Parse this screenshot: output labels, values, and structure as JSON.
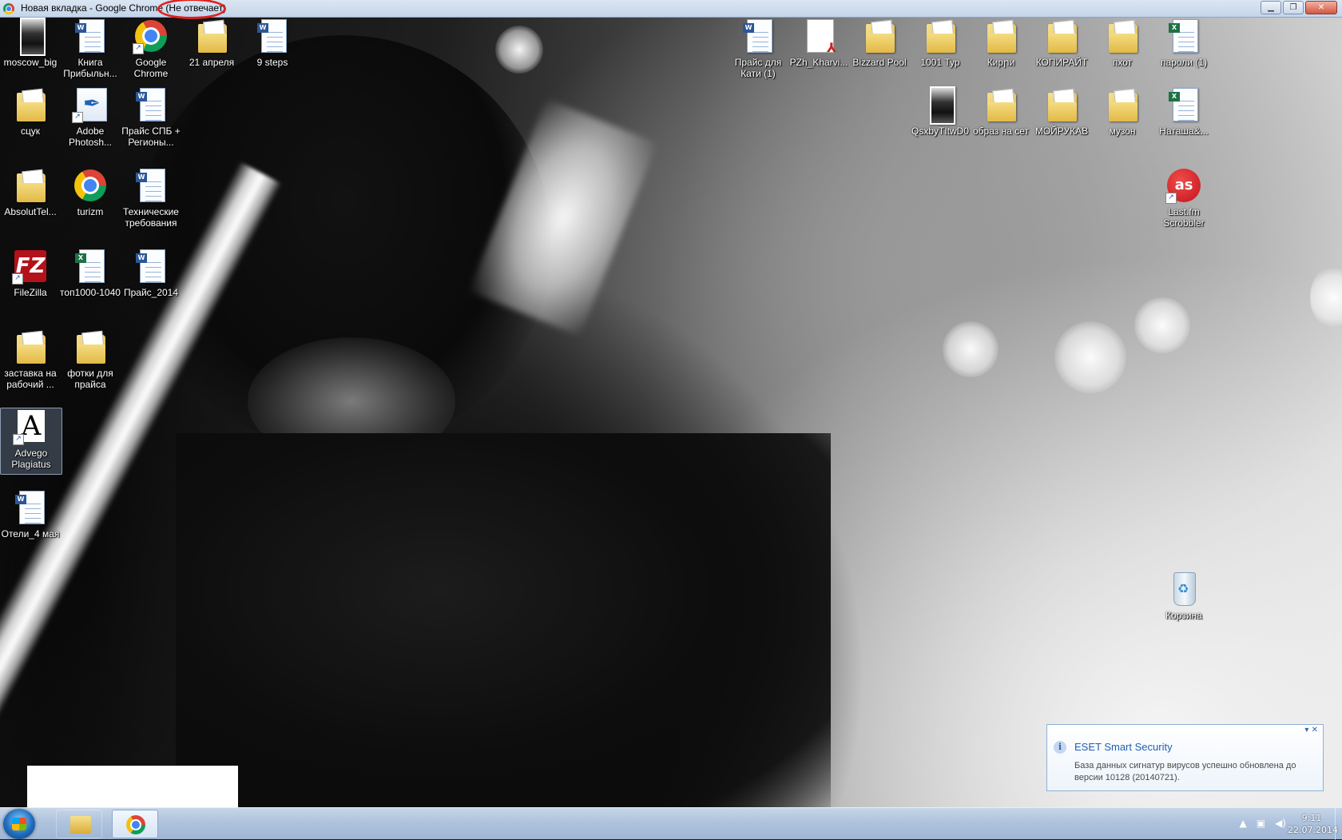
{
  "window": {
    "title": "Новая вкладка - Google Chrome (Не отвечает)",
    "buttons": {
      "minimize": "▁",
      "maximize": "❐",
      "close": "✕"
    }
  },
  "desktop": {
    "icons": [
      {
        "label": "moscow_big",
        "type": "photo"
      },
      {
        "label": "Книга Прибыльн...",
        "type": "doc-word"
      },
      {
        "label": "Google Chrome",
        "type": "chrome"
      },
      {
        "label": "21 апреля",
        "type": "folder"
      },
      {
        "label": "9 steps",
        "type": "doc-word"
      },
      {
        "label": "сцук",
        "type": "folder"
      },
      {
        "label": "Adobe Photosh...",
        "type": "photoshop"
      },
      {
        "label": "Прайс СПБ + Регионы...",
        "type": "doc-word"
      },
      {
        "label": "AbsolutTel...",
        "type": "folder"
      },
      {
        "label": "turizm",
        "type": "chrome"
      },
      {
        "label": "Технические требования",
        "type": "doc-word"
      },
      {
        "label": "FileZilla",
        "type": "filezilla"
      },
      {
        "label": "топ1000-1040",
        "type": "doc-excel"
      },
      {
        "label": "Прайс_2014",
        "type": "doc-word"
      },
      {
        "label": "заставка на рабочий ...",
        "type": "folder"
      },
      {
        "label": "фотки для прайса",
        "type": "folder"
      },
      {
        "label": "Advego Plagiatus",
        "type": "advego"
      },
      {
        "label": "Отели_4 мая",
        "type": "doc-word"
      },
      {
        "label": "Прайс для Кати (1)",
        "type": "doc-word"
      },
      {
        "label": "PZh_Kharvi...",
        "type": "pdf"
      },
      {
        "label": "Bizzard Pool",
        "type": "folder"
      },
      {
        "label": "1001 Тур",
        "type": "folder"
      },
      {
        "label": "Кирրи",
        "type": "folder"
      },
      {
        "label": "КОПИРАЙТ",
        "type": "folder"
      },
      {
        "label": "пхот",
        "type": "folder"
      },
      {
        "label": "пароли (1)",
        "type": "doc-excel"
      },
      {
        "label": "QsxbyTItwD0",
        "type": "photo"
      },
      {
        "label": "образ на сет",
        "type": "folder"
      },
      {
        "label": "МОЙРУКАВ",
        "type": "folder"
      },
      {
        "label": "музон",
        "type": "folder"
      },
      {
        "label": "Наташа&...",
        "type": "doc-excel"
      },
      {
        "label": "Last.fm Scrobbler",
        "type": "lastfm"
      },
      {
        "label": "Корзина",
        "type": "recycle-bin"
      }
    ]
  },
  "notification": {
    "title": "ESET Smart Security",
    "body": "База данных сигнатур вирусов успешно обновлена до версии 10128 (20140721).",
    "controls": "▾ ✕",
    "info_glyph": "i"
  },
  "taskbar": {
    "time": "9:11",
    "date": "22.07.2014",
    "tray_icons": [
      "show-hidden-icons",
      "network-icon",
      "volume-icon"
    ]
  },
  "glyphs": {
    "filezilla": "FZ",
    "lastfm": "as",
    "advego": "A",
    "shortcut": "↗",
    "word_badge": "W",
    "excel_badge": "X",
    "tray_up": "▲",
    "tray_net": "▣",
    "tray_vol": "◀)"
  },
  "colors": {
    "not_responding_circle": "#e0201c",
    "notification_title": "#1f5fb4"
  }
}
